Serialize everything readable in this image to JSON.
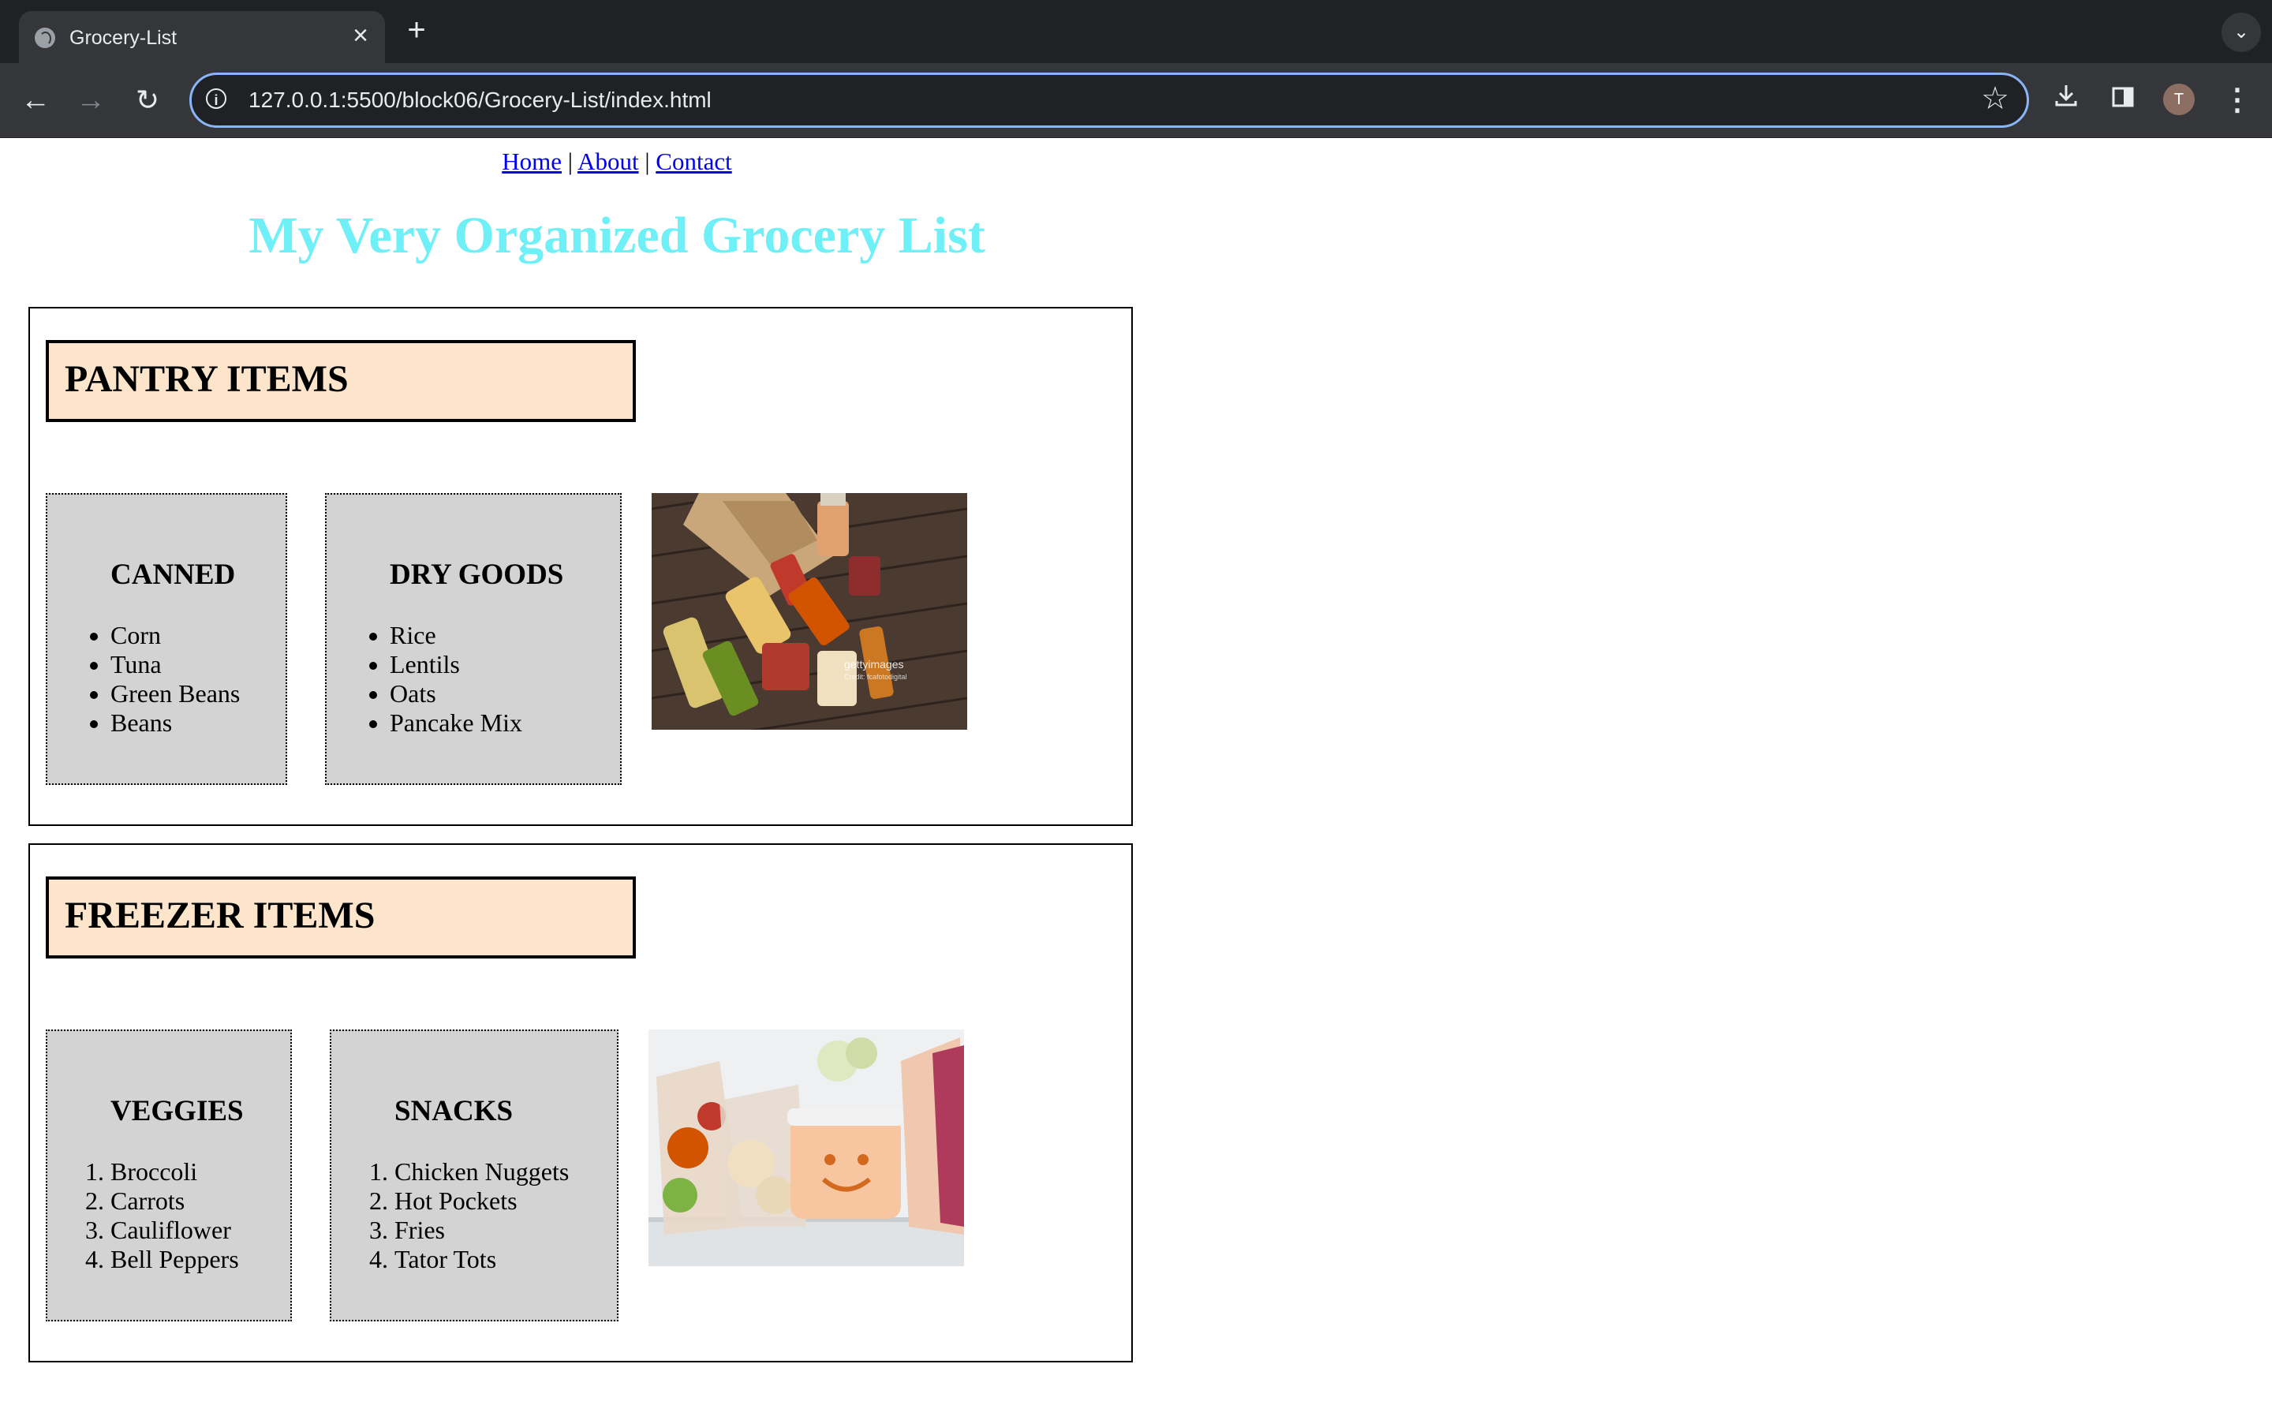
{
  "browser": {
    "tab_title": "Grocery-List",
    "url": "127.0.0.1:5500/block06/Grocery-List/index.html",
    "profile_initial": "T"
  },
  "nav": {
    "links": [
      "Home",
      "About",
      "Contact"
    ],
    "separator": "|"
  },
  "page_title": "My Very Organized Grocery List",
  "sections": [
    {
      "heading": "PANTRY ITEMS",
      "cards": [
        {
          "title": "CANNED",
          "list_type": "bullet",
          "items": [
            "Corn",
            "Tuna",
            "Green Beans",
            "Beans"
          ]
        },
        {
          "title": "DRY GOODS",
          "list_type": "bullet",
          "items": [
            "Rice",
            "Lentils",
            "Oats",
            "Pancake Mix"
          ]
        }
      ],
      "image": {
        "name": "pantry-photo",
        "watermark": "gettyimages",
        "credit": "Credit: fcafotodigital"
      }
    },
    {
      "heading": "FREEZER ITEMS",
      "cards": [
        {
          "title": "VEGGIES",
          "list_type": "numbered",
          "items": [
            "Broccoli",
            "Carrots",
            "Cauliflower",
            "Bell Peppers"
          ]
        },
        {
          "title": "SNACKS",
          "list_type": "numbered",
          "items": [
            "Chicken Nuggets",
            "Hot Pockets",
            "Fries",
            "Tator Tots"
          ]
        }
      ],
      "image": {
        "name": "freezer-photo"
      }
    }
  ],
  "colors": {
    "title": "#6ff0f6",
    "section_heading_bg": "#fce5cb",
    "card_bg": "#d3d3d3",
    "link": "#0000ee",
    "omnibox_focus": "#8ab4f8"
  }
}
